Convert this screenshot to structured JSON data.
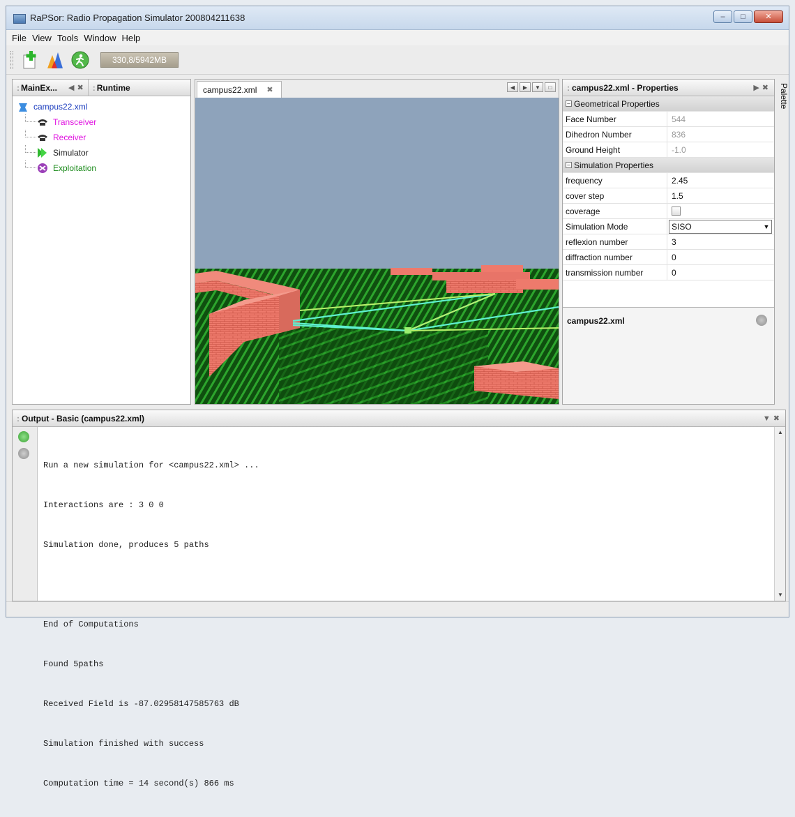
{
  "window": {
    "title": "RaPSor: Radio Propagation Simulator 200804211638"
  },
  "menu": [
    "File",
    "View",
    "Tools",
    "Window",
    "Help"
  ],
  "toolbar": {
    "memory": "330,8/5942MB",
    "buttons": [
      "new-document-icon",
      "chart-icon",
      "run-icon"
    ]
  },
  "explorer": {
    "tab_main": "MainEx...",
    "tab_runtime": "Runtime",
    "root": "campus22.xml",
    "items": [
      {
        "label": "Transceiver",
        "color": "#e010e0",
        "icon": "phone-icon"
      },
      {
        "label": "Receiver",
        "color": "#e010e0",
        "icon": "phone-icon"
      },
      {
        "label": "Simulator",
        "color": "#222222",
        "icon": "play-icon"
      },
      {
        "label": "Exploitation",
        "color": "#1a8a1a",
        "icon": "exploitation-icon"
      }
    ]
  },
  "editor": {
    "tab": "campus22.xml"
  },
  "properties": {
    "header": "campus22.xml - Properties",
    "sections": [
      {
        "title": "Geometrical Properties",
        "rows": [
          {
            "name": "Face Number",
            "value": "544"
          },
          {
            "name": "Dihedron Number",
            "value": "836"
          },
          {
            "name": "Ground Height",
            "value": "-1.0"
          }
        ]
      },
      {
        "title": "Simulation Properties",
        "rows": [
          {
            "name": "frequency",
            "value": "2.45"
          },
          {
            "name": "cover step",
            "value": "1.5"
          },
          {
            "name": "coverage",
            "value": ""
          },
          {
            "name": "Simulation Mode",
            "value": "SISO"
          },
          {
            "name": "reflexion number",
            "value": "3"
          },
          {
            "name": "diffraction number",
            "value": "0"
          },
          {
            "name": "transmission number",
            "value": "0"
          }
        ]
      }
    ],
    "description_title": "campus22.xml"
  },
  "palette": "Palette",
  "output": {
    "header": "Output - Basic (campus22.xml)",
    "lines": [
      "Run a new simulation for <campus22.xml> ...",
      "Interactions are : 3 0 0",
      "Simulation done, produces 5 paths",
      "",
      "End of Computations",
      "Found 5paths",
      "Received Field is -87.02958147585763 dB",
      "Simulation finished with success",
      "Computation time = 14 second(s) 866 ms"
    ]
  },
  "colors": {
    "sky": "#8ea3bb",
    "ground": "#1e6a1e",
    "brick": "#e8786a",
    "ray": "#5ff0d0"
  }
}
